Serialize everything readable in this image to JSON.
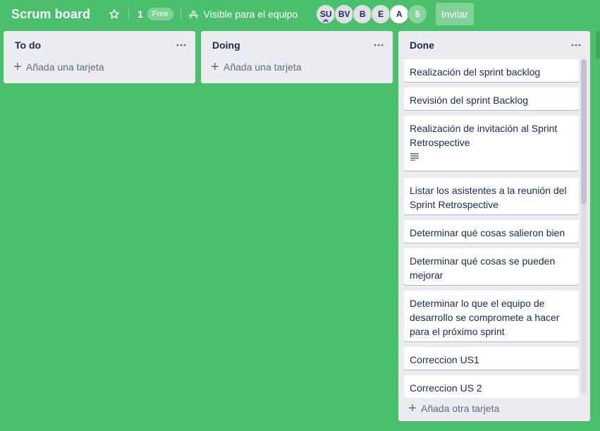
{
  "board": {
    "title": "Scrum board",
    "workspace_count": "1",
    "plan_badge": "Free",
    "visibility": "Visible para el equipo",
    "invite_label": "Invitar",
    "members": [
      {
        "initials": "SU",
        "style": "grey",
        "admin": true
      },
      {
        "initials": "BV",
        "style": "grey"
      },
      {
        "initials": "B",
        "style": "grey"
      },
      {
        "initials": "E",
        "style": "grey"
      },
      {
        "initials": "A",
        "style": "white"
      },
      {
        "initials": "5",
        "style": "more"
      }
    ]
  },
  "lists": [
    {
      "title": "To do",
      "add_card_label": "Añada una tarjeta",
      "cards": []
    },
    {
      "title": "Doing",
      "add_card_label": "Añada una tarjeta",
      "cards": []
    },
    {
      "title": "Done",
      "add_card_label": "Añada otra tarjeta",
      "cards": [
        {
          "text": "Realización del sprint backlog"
        },
        {
          "text": "Revisión del sprint Backlog"
        },
        {
          "text": "Realización de invitación al Sprint Retrospective",
          "has_description": true
        },
        {
          "text": "Listar los asistentes a la reunión del Sprint Retrospective"
        },
        {
          "text": "Determinar qué cosas salieron bien"
        },
        {
          "text": "Determinar qué cosas se pueden mejorar"
        },
        {
          "text": "Determinar lo que el equipo de desarrollo se compromete a hacer para el próximo sprint"
        },
        {
          "text": "Correccion US1"
        },
        {
          "text": "Correccion US 2"
        }
      ]
    }
  ]
}
